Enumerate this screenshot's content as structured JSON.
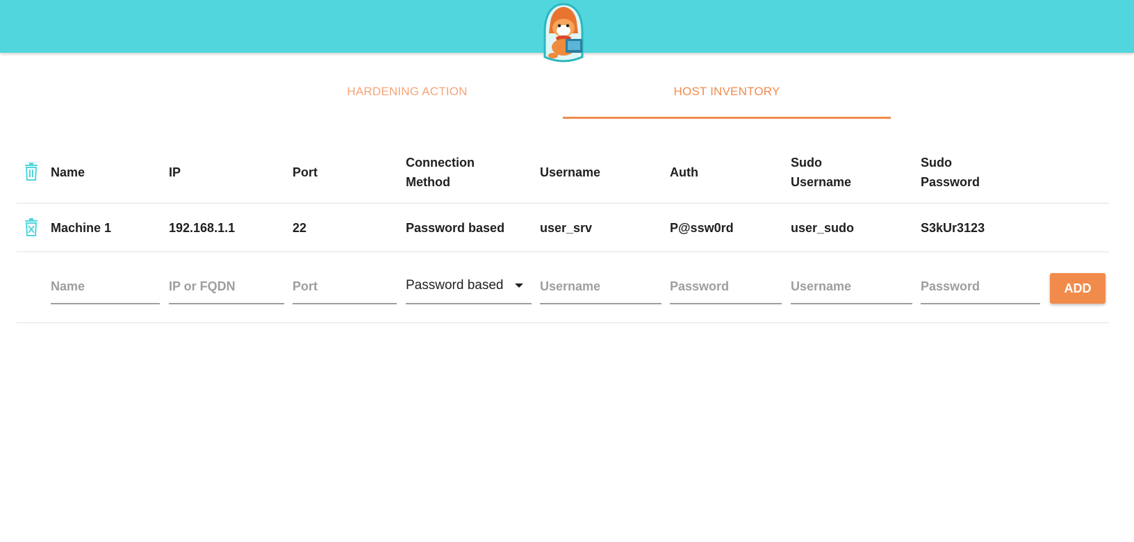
{
  "colors": {
    "header_bg": "#50d6dc",
    "accent": "#f18b4b",
    "accent_light": "#f5a57a",
    "icon_teal": "#50d6dc"
  },
  "header": {
    "logo_icon": "fox-hacker-mascot-icon"
  },
  "tabs": [
    {
      "label": "HARDENING ACTION",
      "active": false
    },
    {
      "label": "HOST INVENTORY",
      "active": true
    }
  ],
  "table": {
    "delete_all_icon": "trash-icon",
    "columns": {
      "name": "Name",
      "ip": "IP",
      "port": "Port",
      "conn_1": "Connection",
      "conn_2": "Method",
      "username": "Username",
      "auth": "Auth",
      "sudo_user_1": "Sudo",
      "sudo_user_2": "Username",
      "sudo_pass_1": "Sudo",
      "sudo_pass_2": "Password"
    },
    "rows": [
      {
        "delete_icon": "delete-row-icon",
        "name": "Machine 1",
        "ip": "192.168.1.1",
        "port": "22",
        "connection_method": "Password based",
        "username": "user_srv",
        "auth": "P@ssw0rd",
        "sudo_username": "user_sudo",
        "sudo_password": "S3kUr3123"
      }
    ]
  },
  "add_form": {
    "name_placeholder": "Name",
    "ip_placeholder": "IP or FQDN",
    "port_placeholder": "Port",
    "connection_method_selected": "Password based",
    "username_placeholder": "Username",
    "auth_placeholder": "Password",
    "sudo_username_placeholder": "Username",
    "sudo_password_placeholder": "Password",
    "add_label": "ADD"
  }
}
